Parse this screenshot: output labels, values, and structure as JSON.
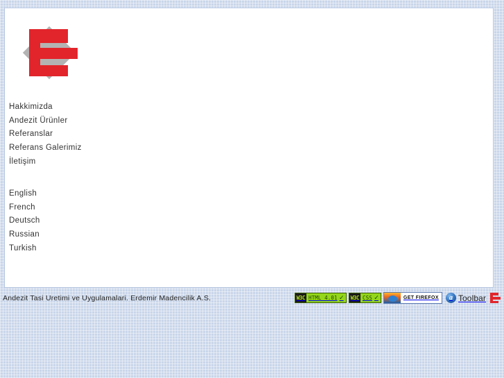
{
  "site": {
    "logo_alt": "Erdemir Madencilik E logo"
  },
  "main_nav": {
    "items": [
      {
        "label": "Hakkimizda"
      },
      {
        "label": "Andezit Ürünler"
      },
      {
        "label": "Referanslar"
      },
      {
        "label": "Referans Galerimiz"
      },
      {
        "label": "İletişim"
      }
    ]
  },
  "language_nav": {
    "items": [
      {
        "label": "English"
      },
      {
        "label": "French"
      },
      {
        "label": "Deutsch"
      },
      {
        "label": "Russian"
      },
      {
        "label": "Turkish"
      }
    ]
  },
  "footer": {
    "text": "Andezit Tasi Uretimi ve Uygulamalari. Erdemir Madencilik A.S.",
    "badges": {
      "html_validator": {
        "mark": "W3C",
        "label": "HTML 4.01",
        "tick": "✓"
      },
      "css_validator": {
        "mark": "W3C",
        "label": "CSS",
        "tick": "✓"
      },
      "firefox": {
        "label": "GET FIREFOX"
      },
      "toolbar": {
        "icon_letter": "a",
        "label": "Toolbar"
      }
    }
  },
  "colors": {
    "brand_red": "#e2252b",
    "logo_gray": "#b3b3b3",
    "page_background": "#c9d6ea",
    "content_background": "#ffffff",
    "text": "#333333",
    "validator_green": "#94d71a"
  }
}
